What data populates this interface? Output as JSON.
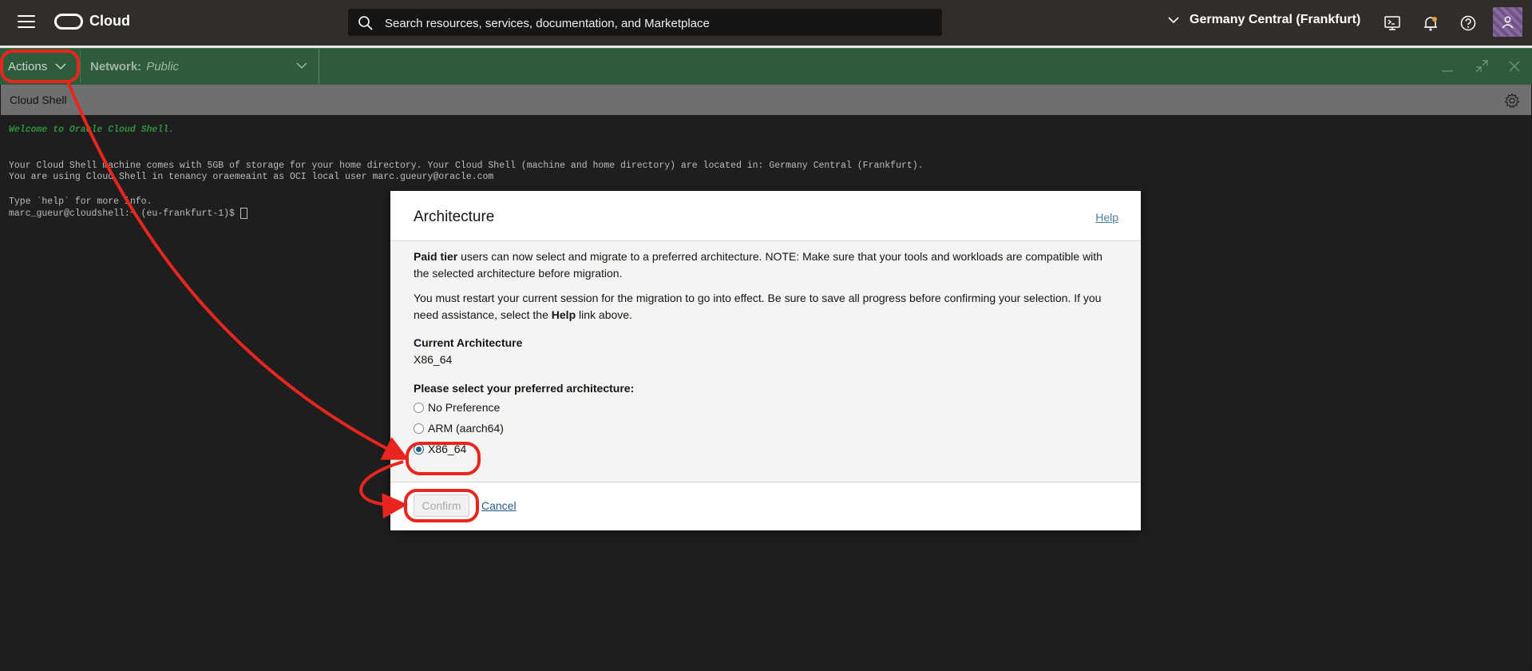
{
  "topbar": {
    "menu_icon": "hamburger-icon",
    "brand": "Cloud",
    "search_placeholder": "Search resources, services, documentation, and Marketplace",
    "region": "Germany Central (Frankfurt)",
    "icons": [
      "cloud-shell-icon",
      "bell-icon",
      "help-icon",
      "user-icon"
    ]
  },
  "shellbar": {
    "actions_label": "Actions",
    "network_key": "Network:",
    "network_value": "Public"
  },
  "shell": {
    "title": "Cloud Shell"
  },
  "terminal": {
    "lines": [
      "Welcome to Oracle Cloud Shell.",
      "Your Cloud Shell machine comes with 5GB of storage for your home directory. Your Cloud Shell (machine and home directory) are located in: Germany Central (Frankfurt).",
      "You are using Cloud Shell in tenancy oraemeaint as OCI local user marc.gueury@oracle.com",
      "Type `help` for more info.",
      "marc_gueur@cloudshell:~ (eu-frankfurt-1)$ "
    ]
  },
  "dialog": {
    "title": "Architecture",
    "help_link": "Help",
    "para1_bold": "Paid tier",
    "para1_rest": " users can now select and migrate to a preferred architecture. NOTE: Make sure that your tools and workloads are compatible with the selected architecture before migration.",
    "para2_start": "You must restart your current session for the migration to go into effect. Be sure to save all progress before confirming your selection. If you need assistance, select the ",
    "para2_bold": "Help",
    "para2_end": " link above.",
    "current_label": "Current Architecture",
    "current_value": "X86_64",
    "select_label": "Please select your preferred architecture:",
    "options": [
      "No Preference",
      "ARM (aarch64)",
      "X86_64"
    ],
    "selected_option": "X86_64",
    "confirm_label": "Confirm",
    "cancel_label": "Cancel"
  },
  "annotation": {
    "color": "#e8261f"
  }
}
